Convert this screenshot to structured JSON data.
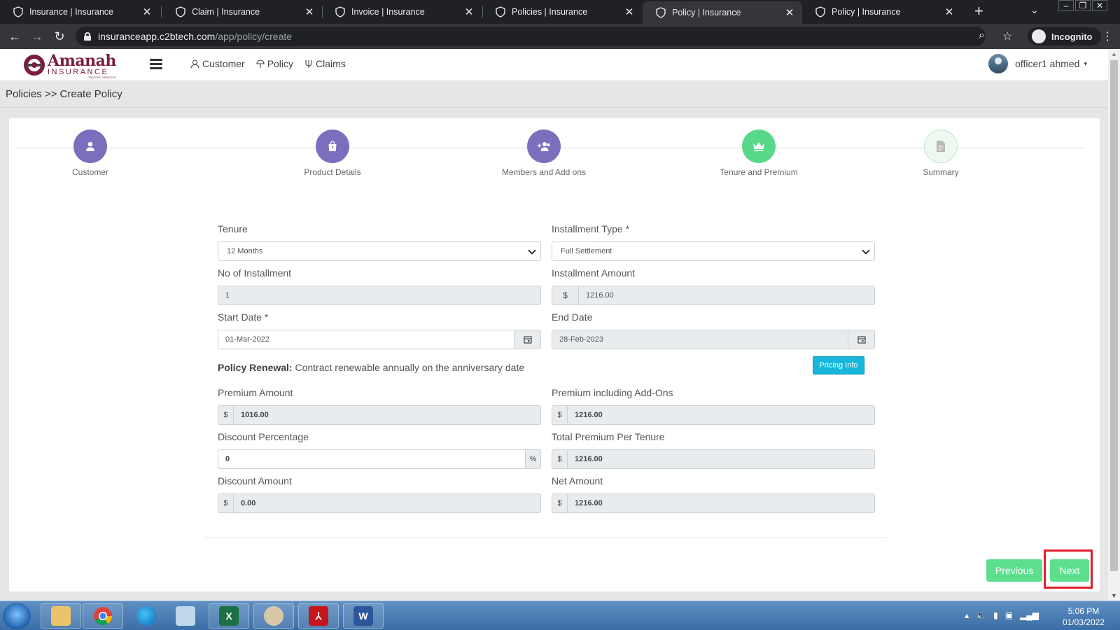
{
  "browser": {
    "tabs": [
      {
        "title": "Insurance | Insurance",
        "active": false
      },
      {
        "title": "Claim | Insurance",
        "active": false
      },
      {
        "title": "Invoice | Insurance",
        "active": false
      },
      {
        "title": "Policies | Insurance",
        "active": false
      },
      {
        "title": "Policy | Insurance",
        "active": true
      },
      {
        "title": "Policy | Insurance",
        "active": false
      }
    ],
    "url_host": "insuranceapp.c2btech.com",
    "url_path": "/app/policy/create",
    "incognito_label": "Incognito"
  },
  "app": {
    "logo_name": "Amanah",
    "logo_sub": "INSURANCE",
    "logo_tagline": "TRUSTED SERVICES",
    "nav": [
      "Customer",
      "Policy",
      "Claims"
    ],
    "user_name": "officer1 ahmed"
  },
  "breadcrumb": "Policies >> Create Policy",
  "stepper": [
    {
      "label": "Customer",
      "state": "done",
      "icon": "user-icon"
    },
    {
      "label": "Product Details",
      "state": "done",
      "icon": "bag-icon"
    },
    {
      "label": "Members and Add ons",
      "state": "done",
      "icon": "user-plus-icon"
    },
    {
      "label": "Tenure and Premium",
      "state": "active",
      "icon": "crown-icon"
    },
    {
      "label": "Summary",
      "state": "pending",
      "icon": "document-icon"
    }
  ],
  "form": {
    "tenure": {
      "label": "Tenure",
      "value": "12 Months"
    },
    "installment_type": {
      "label": "Installment Type *",
      "value": "Full Settlement"
    },
    "no_installment": {
      "label": "No of Installment",
      "value": "1"
    },
    "installment_amount": {
      "label": "Installment Amount",
      "currency": "$",
      "value": "1216.00"
    },
    "start_date": {
      "label": "Start Date *",
      "value": "01-Mar-2022"
    },
    "end_date": {
      "label": "End Date",
      "value": "28-Feb-2023"
    },
    "renewal": {
      "title": "Policy Renewal:",
      "text": "Contract renewable annually on the anniversary date"
    },
    "pricing_info": "Pricing Info",
    "premium_amount": {
      "label": "Premium Amount",
      "currency": "$",
      "value": "1016.00"
    },
    "premium_addons": {
      "label": "Premium including Add-Ons",
      "currency": "$",
      "value": "1216.00"
    },
    "discount_percentage": {
      "label": "Discount Percentage",
      "value": "0",
      "suffix": "%"
    },
    "total_premium": {
      "label": "Total Premium Per Tenure",
      "currency": "$",
      "value": "1216.00"
    },
    "discount_amount": {
      "label": "Discount Amount",
      "currency": "$",
      "value": "0.00"
    },
    "net_amount": {
      "label": "Net Amount",
      "currency": "$",
      "value": "1216.00"
    }
  },
  "buttons": {
    "previous": "Previous",
    "next": "Next"
  },
  "colors": {
    "step_done": "#7a6ebd",
    "step_active": "#58d98a",
    "button": "#5ce08e",
    "pricing": "#17b6dc",
    "highlight": "#e01e2d"
  },
  "taskbar": {
    "time": "5:06 PM",
    "date": "01/03/2022"
  }
}
